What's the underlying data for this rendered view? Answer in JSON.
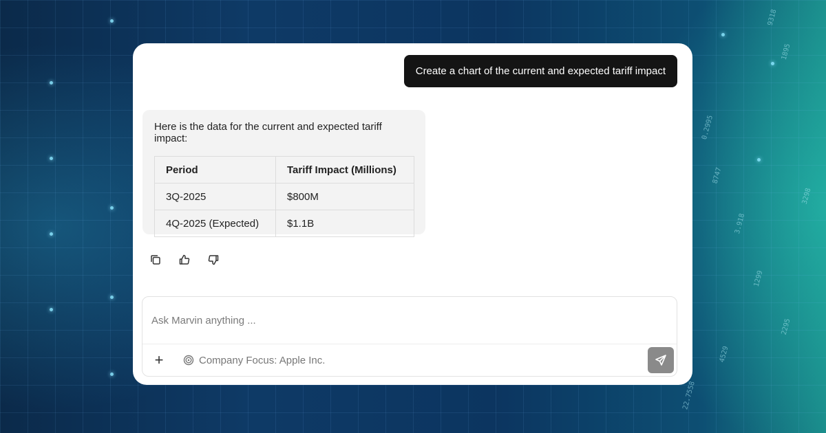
{
  "chat": {
    "user_message": "Create a chart of the current and expected tariff impact",
    "bot_intro": "Here is the data for the current and expected tariff impact:",
    "table": {
      "headers": [
        "Period",
        "Tariff Impact (Millions)"
      ],
      "rows": [
        [
          "3Q-2025",
          "$800M"
        ],
        [
          "4Q-2025 (Expected)",
          "$1.1B"
        ]
      ]
    },
    "actions": {
      "copy_icon": "copy-icon",
      "like_icon": "thumbs-up-icon",
      "dislike_icon": "thumbs-down-icon"
    }
  },
  "composer": {
    "placeholder": "Ask Marvin anything ...",
    "plus_label": "+",
    "focus_label": "Company Focus: Apple Inc.",
    "focus_icon": "target-icon",
    "send_icon": "send-icon"
  },
  "colors": {
    "user_bubble": "#141414",
    "bot_bubble": "#f3f3f3",
    "send_button": "#8a8a8a",
    "card": "#ffffff"
  }
}
